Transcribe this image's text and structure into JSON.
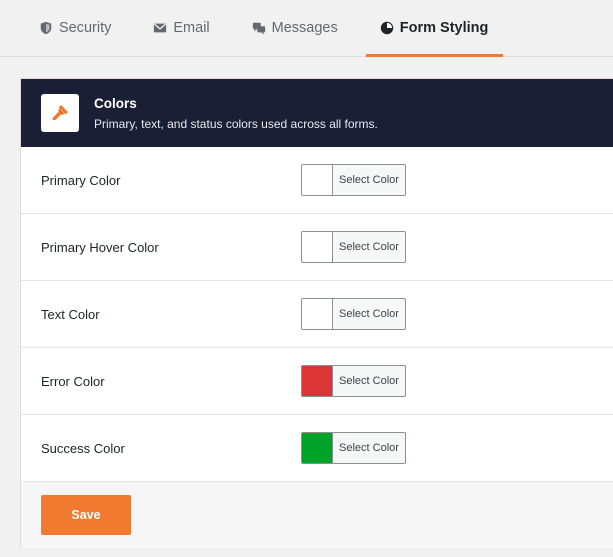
{
  "tabs": [
    {
      "label": "Security",
      "icon": "shield-icon",
      "active": false
    },
    {
      "label": "Email",
      "icon": "envelope-icon",
      "active": false
    },
    {
      "label": "Messages",
      "icon": "chat-icon",
      "active": false
    },
    {
      "label": "Form Styling",
      "icon": "palette-icon",
      "active": true
    }
  ],
  "section": {
    "title": "Colors",
    "subtitle": "Primary, text, and status colors used across all forms.",
    "icon": "brush-icon"
  },
  "fields": [
    {
      "label": "Primary Color",
      "value": "#ffffff",
      "button": "Select Color"
    },
    {
      "label": "Primary Hover Color",
      "value": "#ffffff",
      "button": "Select Color"
    },
    {
      "label": "Text Color",
      "value": "#ffffff",
      "button": "Select Color"
    },
    {
      "label": "Error Color",
      "value": "#dc3535",
      "button": "Select Color"
    },
    {
      "label": "Success Color",
      "value": "#00a32a",
      "button": "Select Color"
    }
  ],
  "save_label": "Save",
  "colors": {
    "accent": "#f27a30",
    "header_bg": "#1a1f36"
  }
}
